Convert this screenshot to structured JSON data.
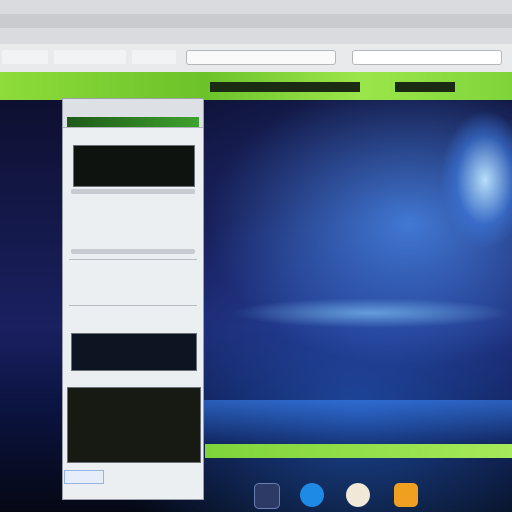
{
  "window": {
    "title": ""
  },
  "tabs": [
    {
      "label": ""
    },
    {
      "label": ""
    },
    {
      "label": ""
    }
  ],
  "address_bar": {
    "value": ""
  },
  "search_bar": {
    "value": ""
  },
  "sidepanel": {
    "header_title": "",
    "green_label": "",
    "card1_lines": [
      "",
      "",
      ""
    ],
    "text_rows": [
      "",
      "",
      "",
      "",
      "",
      ""
    ],
    "card2_lines": [
      "",
      ""
    ],
    "card3_lines": [
      "",
      "",
      "",
      "",
      ""
    ],
    "footer_link": ""
  },
  "bottom_strip": {
    "text": ""
  },
  "dock": [
    {
      "icon": "window-icon",
      "color": "#2d3a66"
    },
    {
      "icon": "browser-icon",
      "color": "#1e8ae6"
    },
    {
      "icon": "mail-icon",
      "color": "#f2e8d8"
    },
    {
      "icon": "app-icon",
      "color": "#f0a020"
    }
  ],
  "colors": {
    "accent_green": "#7fd43a",
    "panel_bg": "#eceff2",
    "desktop_bg": "#1a2060"
  }
}
